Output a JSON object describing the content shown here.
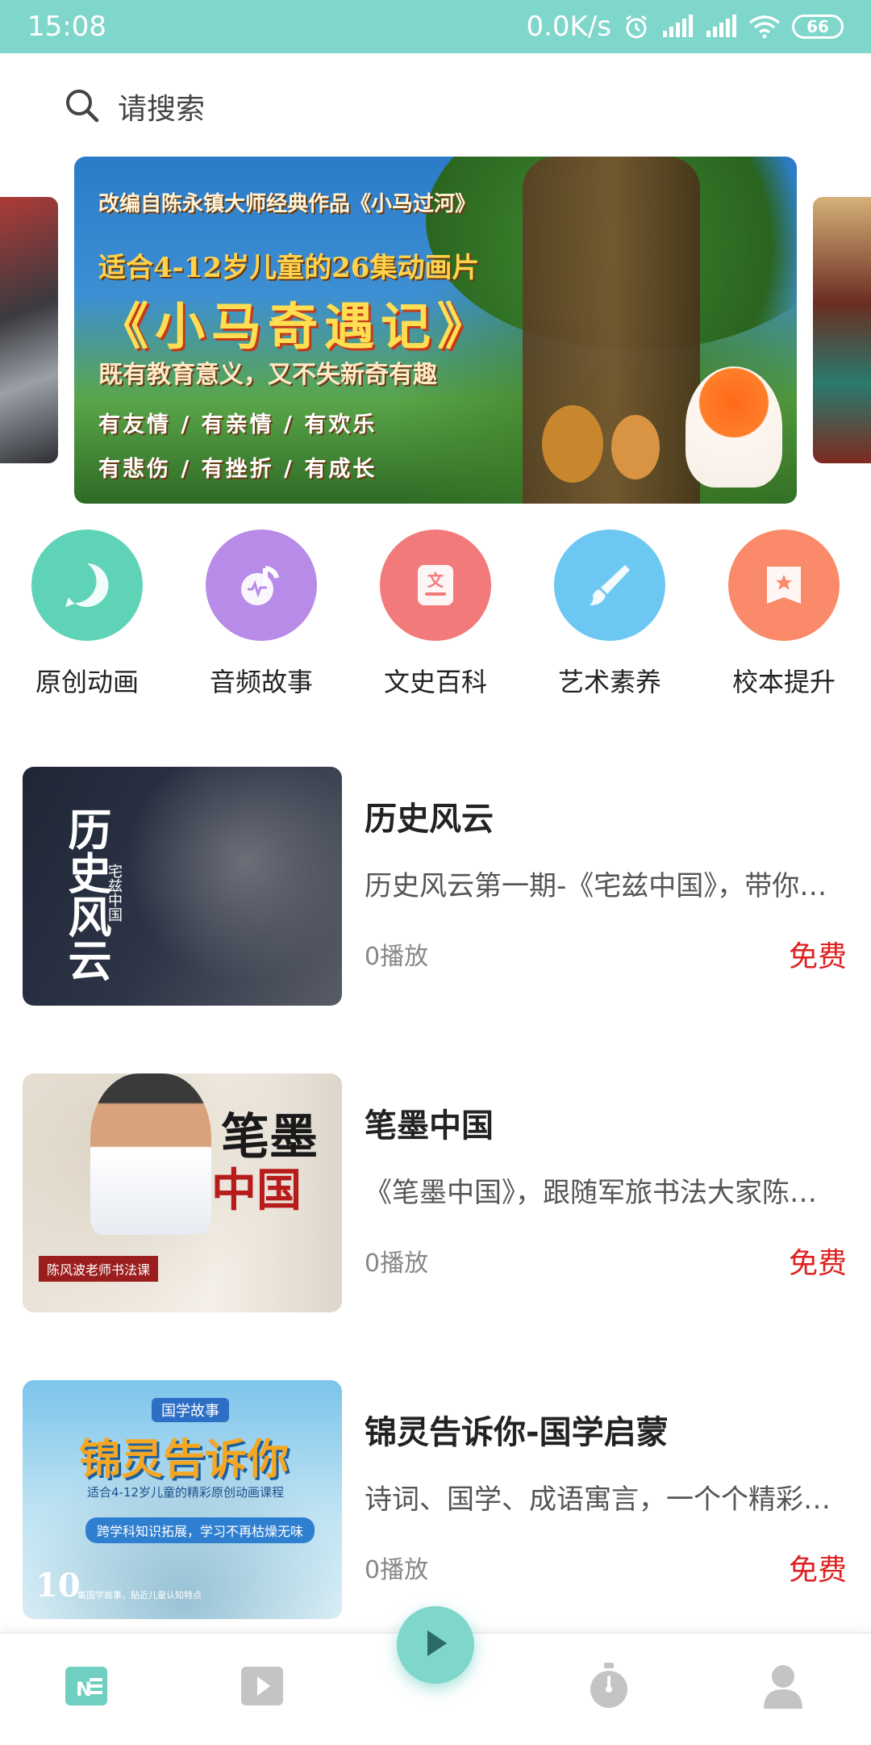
{
  "status_bar": {
    "time": "15:08",
    "network_speed": "0.0K/s",
    "battery": "66",
    "bg_color": "#7fd6cb"
  },
  "search": {
    "placeholder": "请搜索",
    "icon": "search-icon"
  },
  "banner": {
    "line_top": "改编自陈永镇大师经典作品《小马过河》",
    "line_sub": "适合4-12岁儿童的26集动画片",
    "title": "《小马奇遇记》",
    "desc": "既有教育意义，又不失新奇有趣",
    "row1": "有友情  /  有亲情  /  有欢乐",
    "row2": "有悲伤  /  有挫折  /  有成长"
  },
  "categories": [
    {
      "label": "原创动画",
      "icon": "animation-play-icon",
      "color": "#5fd3b8"
    },
    {
      "label": "音频故事",
      "icon": "music-note-icon",
      "color": "#b98be8"
    },
    {
      "label": "文史百科",
      "icon": "document-icon",
      "color": "#f27a7a"
    },
    {
      "label": "艺术素养",
      "icon": "paint-brush-icon",
      "color": "#6cc8f2"
    },
    {
      "label": "校本提升",
      "icon": "star-book-icon",
      "color": "#fa8a6a"
    }
  ],
  "courses": [
    {
      "title": "历史风云",
      "desc": "历史风云第一期-《宅兹中国》，带你学习不一样的历史",
      "plays": "0播放",
      "price": "免费",
      "thumb": {
        "calligraphy": "历史风云",
        "sub": "宅兹中国"
      }
    },
    {
      "title": "笔墨中国",
      "desc": "《笔墨中国》，跟随军旅书法大家陈风波老师学书法",
      "plays": "0播放",
      "price": "免费",
      "thumb": {
        "calligraphy": "笔墨",
        "red": "中国",
        "ribbon": "陈风波老师书法课"
      }
    },
    {
      "title": "锦灵告诉你-国学启蒙",
      "desc": "诗词、国学、成语寓言，一个个精彩的故事",
      "plays": "0播放",
      "price": "免费",
      "thumb": {
        "badge": "国学故事",
        "calligraphy": "锦灵告诉你",
        "line": "适合4-12岁儿童的精彩原创动画课程",
        "pill": "跨学科知识拓展，学习不再枯燥无味",
        "num": "10",
        "tiny": "集国学故事，贴近儿童认知特点"
      }
    }
  ],
  "bottom_nav": {
    "items": [
      {
        "icon": "news-icon",
        "color": "#6fd0c2"
      },
      {
        "icon": "video-icon",
        "color": "#c4c4c4"
      },
      {
        "icon": "stopwatch-icon",
        "color": "#c4c4c4"
      },
      {
        "icon": "profile-icon",
        "color": "#c4c4c4"
      }
    ],
    "play_button_icon": "play-icon"
  },
  "colors": {
    "accent": "#7fd6cb",
    "price": "#e02020"
  }
}
